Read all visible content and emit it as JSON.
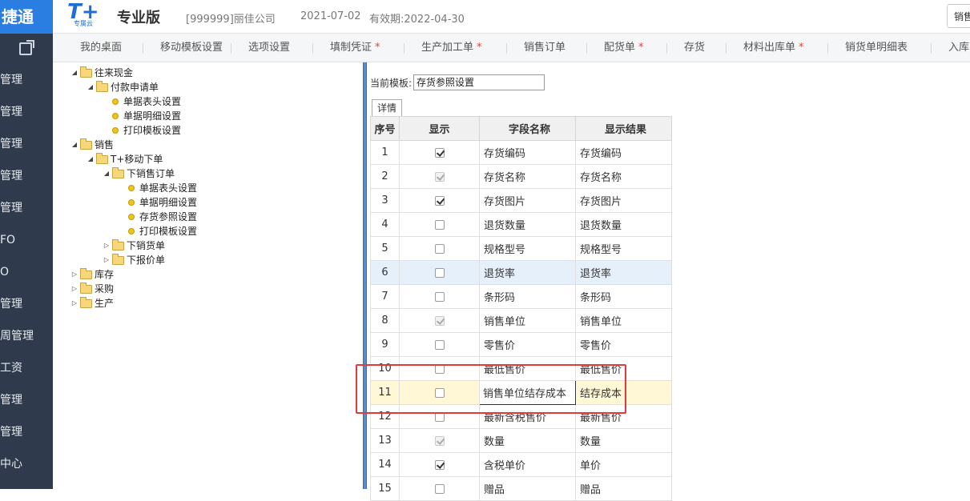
{
  "header": {
    "brand_text": "捷通",
    "logo_text": "T+",
    "logo_sub": "专属云",
    "edition": "专业版",
    "company": "[999999]丽佳公司",
    "date": "2021-07-02",
    "validity": "有效期:2022-04-30",
    "top_right_text": "销售"
  },
  "sidebar": {
    "items": [
      "管理",
      "管理",
      "管理",
      "管理",
      "管理",
      "FO",
      "O",
      "管理",
      "周管理",
      "工资",
      "管理",
      "管理",
      "中心"
    ]
  },
  "tabs": [
    {
      "label": "我的桌面",
      "starred": false
    },
    {
      "label": "移动模板设置",
      "starred": false
    },
    {
      "label": "选项设置",
      "starred": false
    },
    {
      "label": "填制凭证",
      "starred": true
    },
    {
      "label": "生产加工单",
      "starred": true
    },
    {
      "label": "销售订单",
      "starred": false
    },
    {
      "label": "配货单",
      "starred": true
    },
    {
      "label": "存货",
      "starred": false
    },
    {
      "label": "材料出库单",
      "starred": true
    },
    {
      "label": "销货单明细表",
      "starred": false
    },
    {
      "label": "入库",
      "starred": false
    }
  ],
  "tree": [
    {
      "label": "往来现金",
      "type": "folder",
      "expanded": true
    },
    {
      "label": "付款申请单",
      "type": "folder",
      "expanded": true
    },
    {
      "label": "单据表头设置",
      "type": "leaf"
    },
    {
      "label": "单据明细设置",
      "type": "leaf"
    },
    {
      "label": "打印模板设置",
      "type": "leaf"
    },
    {
      "label": "销售",
      "type": "folder",
      "expanded": true
    },
    {
      "label": "T+移动下单",
      "type": "folder",
      "expanded": true
    },
    {
      "label": "下销售订单",
      "type": "folder",
      "expanded": true
    },
    {
      "label": "单据表头设置",
      "type": "leaf"
    },
    {
      "label": "单据明细设置",
      "type": "leaf"
    },
    {
      "label": "存货参照设置",
      "type": "leaf"
    },
    {
      "label": "打印模板设置",
      "type": "leaf"
    },
    {
      "label": "下销货单",
      "type": "folder",
      "expanded": false
    },
    {
      "label": "下报价单",
      "type": "folder",
      "expanded": false
    },
    {
      "label": "库存",
      "type": "folder",
      "expanded": false
    },
    {
      "label": "采购",
      "type": "folder",
      "expanded": false
    },
    {
      "label": "生产",
      "type": "folder",
      "expanded": false
    }
  ],
  "template": {
    "label": "当前模板:",
    "value": "存货参照设置",
    "detail_tab": "详情"
  },
  "grid": {
    "headers": [
      "序号",
      "显示",
      "字段名称",
      "显示结果"
    ],
    "rows": [
      {
        "no": "1",
        "checked": true,
        "disabled": false,
        "name": "存货编码",
        "result": "存货编码"
      },
      {
        "no": "2",
        "checked": true,
        "disabled": true,
        "name": "存货名称",
        "result": "存货名称"
      },
      {
        "no": "3",
        "checked": true,
        "disabled": false,
        "name": "存货图片",
        "result": "存货图片"
      },
      {
        "no": "4",
        "checked": false,
        "disabled": false,
        "name": "退货数量",
        "result": "退货数量"
      },
      {
        "no": "5",
        "checked": false,
        "disabled": false,
        "name": "规格型号",
        "result": "规格型号"
      },
      {
        "no": "6",
        "checked": false,
        "disabled": false,
        "name": "退货率",
        "result": "退货率"
      },
      {
        "no": "7",
        "checked": false,
        "disabled": false,
        "name": "条形码",
        "result": "条形码"
      },
      {
        "no": "8",
        "checked": true,
        "disabled": true,
        "name": "销售单位",
        "result": "销售单位"
      },
      {
        "no": "9",
        "checked": false,
        "disabled": false,
        "name": "零售价",
        "result": "零售价"
      },
      {
        "no": "10",
        "checked": false,
        "disabled": false,
        "name": "最低售价",
        "result": "最低售价"
      },
      {
        "no": "11",
        "checked": false,
        "disabled": false,
        "name": "销售单位结存成本",
        "result": "结存成本"
      },
      {
        "no": "12",
        "checked": false,
        "disabled": false,
        "name": "最新含税售价",
        "result": "最新售价"
      },
      {
        "no": "13",
        "checked": true,
        "disabled": true,
        "name": "数量",
        "result": "数量"
      },
      {
        "no": "14",
        "checked": true,
        "disabled": false,
        "name": "含税单价",
        "result": "单价"
      },
      {
        "no": "15",
        "checked": false,
        "disabled": false,
        "name": "赠品",
        "result": "赠品"
      }
    ]
  }
}
